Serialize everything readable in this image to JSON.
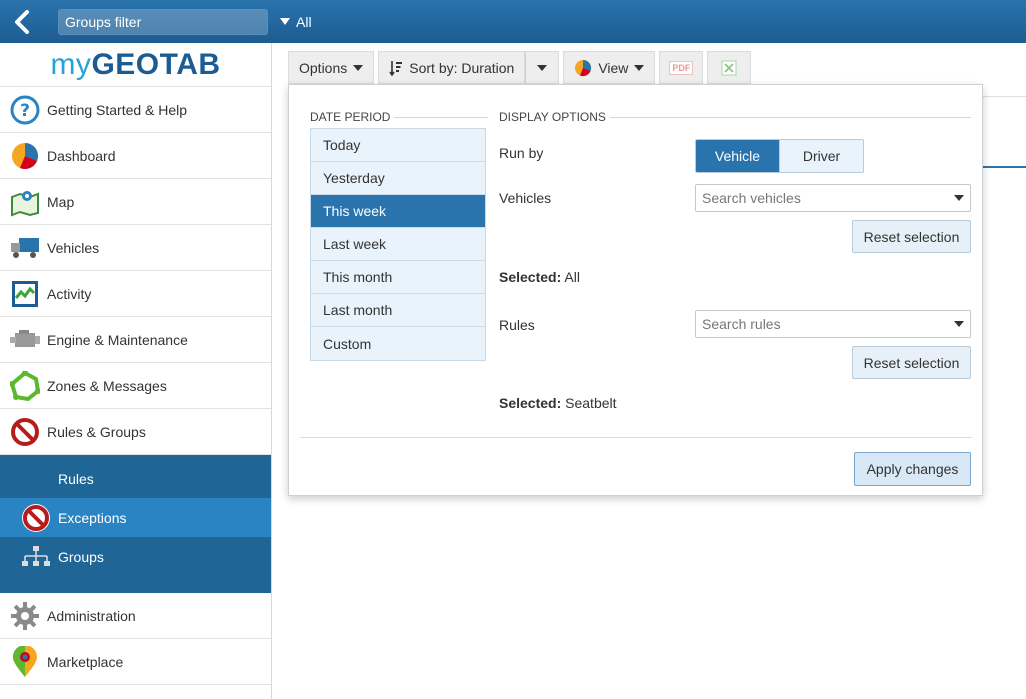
{
  "topbar": {
    "groups_filter_placeholder": "Groups filter",
    "groups_value": "All"
  },
  "logo": {
    "part1": "my",
    "part2": "GEOTAB"
  },
  "sidebar": {
    "items": [
      {
        "label": "Getting Started & Help",
        "icon": "help-icon"
      },
      {
        "label": "Dashboard",
        "icon": "pie-chart-icon"
      },
      {
        "label": "Map",
        "icon": "map-icon"
      },
      {
        "label": "Vehicles",
        "icon": "truck-icon"
      },
      {
        "label": "Activity",
        "icon": "activity-chart-icon"
      },
      {
        "label": "Engine & Maintenance",
        "icon": "engine-icon"
      },
      {
        "label": "Zones & Messages",
        "icon": "zone-icon"
      },
      {
        "label": "Rules & Groups",
        "icon": "no-entry-icon"
      }
    ],
    "sub_items": [
      {
        "label": "Rules"
      },
      {
        "label": "Exceptions",
        "icon": "no-entry-icon"
      },
      {
        "label": "Groups",
        "icon": "org-chart-icon"
      }
    ],
    "bottom_items": [
      {
        "label": "Administration",
        "icon": "gear-icon"
      },
      {
        "label": "Marketplace",
        "icon": "marketplace-icon"
      }
    ]
  },
  "toolbar": {
    "options_label": "Options",
    "sort_label": "Sort by: Duration",
    "view_label": "View",
    "pdf_label": "PDF"
  },
  "panel": {
    "date_period_heading": "DATE PERIOD",
    "display_options_heading": "DISPLAY OPTIONS",
    "periods": [
      "Today",
      "Yesterday",
      "This week",
      "Last week",
      "This month",
      "Last month",
      "Custom"
    ],
    "selected_period": "This week",
    "run_by_label": "Run by",
    "run_by_options": [
      "Vehicle",
      "Driver"
    ],
    "vehicles_label": "Vehicles",
    "vehicles_placeholder": "Search vehicles",
    "reset_label": "Reset selection",
    "selected_prefix": "Selected:",
    "vehicles_selected": "All",
    "rules_label": "Rules",
    "rules_placeholder": "Search rules",
    "rules_selected": "Seatbelt",
    "apply_label": "Apply changes"
  },
  "colors": {
    "brand_blue": "#2a74ad",
    "nav_dark": "#1f6696",
    "nav_selected": "#2a83c2",
    "logo_light": "#25a3d8"
  }
}
